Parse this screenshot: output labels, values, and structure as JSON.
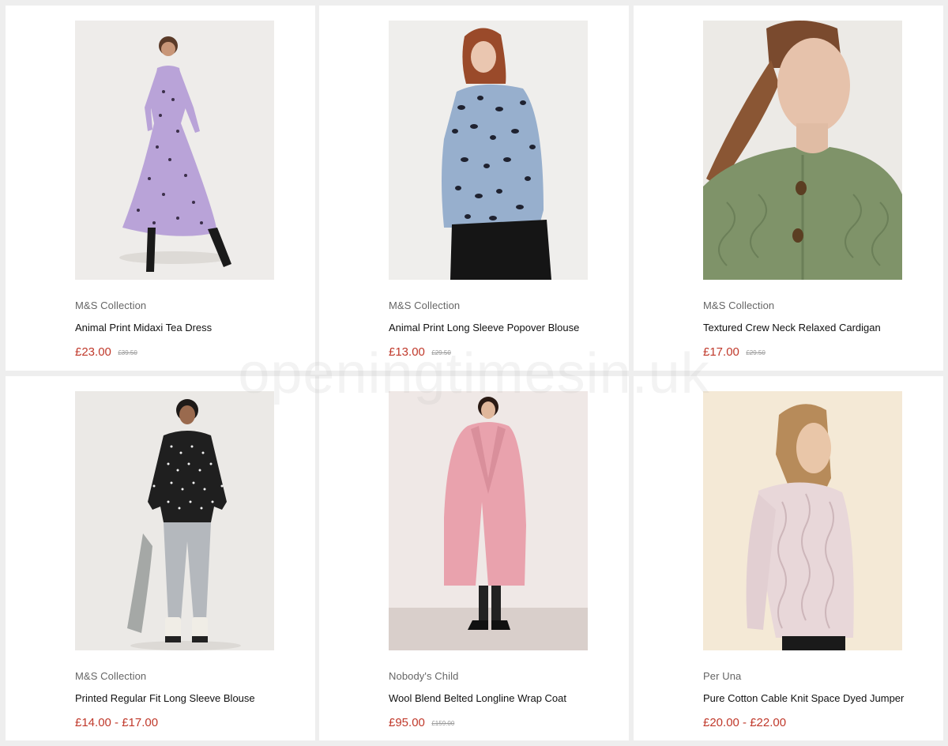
{
  "watermark": "openingtimesin.uk",
  "products": [
    {
      "brand": "M&S Collection",
      "title": "Animal Print Midaxi Tea Dress",
      "price": "£23.00",
      "was": "£39.50"
    },
    {
      "brand": "M&S Collection",
      "title": "Animal Print Long Sleeve Popover Blouse",
      "price": "£13.00",
      "was": "£29.50"
    },
    {
      "brand": "M&S Collection",
      "title": "Textured Crew Neck Relaxed Cardigan",
      "price": "£17.00",
      "was": "£29.50"
    },
    {
      "brand": "M&S Collection",
      "title": "Printed Regular Fit Long Sleeve Blouse",
      "price": "£14.00 - £17.00",
      "was": ""
    },
    {
      "brand": "Nobody's Child",
      "title": "Wool Blend Belted Longline Wrap Coat",
      "price": "£95.00",
      "was": "£159.00"
    },
    {
      "brand": "Per Una",
      "title": "Pure Cotton Cable Knit Space Dyed Jumper",
      "price": "£20.00 - £22.00",
      "was": ""
    }
  ],
  "colors": {
    "price": "#c0392b",
    "card_bg": "#ffffff",
    "page_bg": "#eeeeee"
  }
}
